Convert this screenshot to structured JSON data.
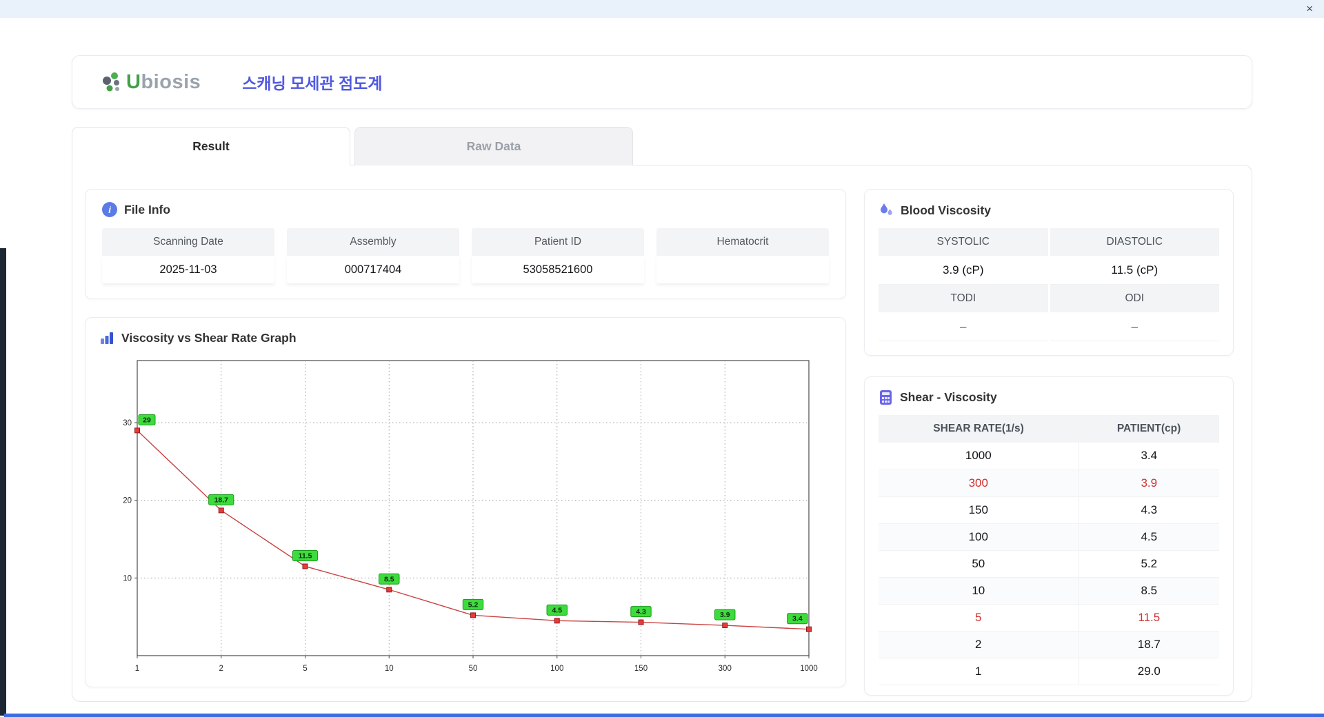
{
  "window": {
    "close_label": "×"
  },
  "header": {
    "brand_u": "U",
    "brand_rest": "biosis",
    "title_korean": "스캐닝 모세관 점도계"
  },
  "tabs": [
    {
      "label": "Result",
      "active": true
    },
    {
      "label": "Raw Data",
      "active": false
    }
  ],
  "icons": {
    "info_glyph": "i"
  },
  "file_info": {
    "title": "File Info",
    "fields": [
      {
        "label": "Scanning Date",
        "value": "2025-11-03"
      },
      {
        "label": "Assembly",
        "value": "000717404"
      },
      {
        "label": "Patient ID",
        "value": "53058521600"
      },
      {
        "label": "Hematocrit",
        "value": ""
      }
    ]
  },
  "blood_viscosity": {
    "title": "Blood Viscosity",
    "cells": [
      {
        "label": "SYSTOLIC",
        "value": "3.9 (cP)"
      },
      {
        "label": "DIASTOLIC",
        "value": "11.5 (cP)"
      },
      {
        "label": "TODI",
        "value": "–"
      },
      {
        "label": "ODI",
        "value": "–"
      }
    ]
  },
  "shear_table": {
    "title": "Shear - Viscosity",
    "columns": [
      "SHEAR RATE(1/s)",
      "PATIENT(cp)"
    ],
    "rows": [
      {
        "shear": "1000",
        "patient": "3.4",
        "highlight": false
      },
      {
        "shear": "300",
        "patient": "3.9",
        "highlight": true
      },
      {
        "shear": "150",
        "patient": "4.3",
        "highlight": false
      },
      {
        "shear": "100",
        "patient": "4.5",
        "highlight": false
      },
      {
        "shear": "50",
        "patient": "5.2",
        "highlight": false
      },
      {
        "shear": "10",
        "patient": "8.5",
        "highlight": false
      },
      {
        "shear": "5",
        "patient": "11.5",
        "highlight": true
      },
      {
        "shear": "2",
        "patient": "18.7",
        "highlight": false
      },
      {
        "shear": "1",
        "patient": "29.0",
        "highlight": false
      }
    ]
  },
  "chart_data": {
    "type": "line",
    "title": "Viscosity vs Shear Rate Graph",
    "categories": [
      "1",
      "2",
      "5",
      "10",
      "50",
      "100",
      "150",
      "300",
      "1000"
    ],
    "values": [
      29,
      18.7,
      11.5,
      8.5,
      5.2,
      4.5,
      4.3,
      3.9,
      3.4
    ],
    "point_labels": [
      "29",
      "18.7",
      "11.5",
      "8.5",
      "5.2",
      "4.5",
      "4.3",
      "3.9",
      "3.4"
    ],
    "xlabel": "",
    "ylabel": "",
    "y_ticks": [
      10,
      20,
      30
    ],
    "ylim": [
      0,
      38
    ],
    "x_scale": "categorical-log-ticks",
    "grid": "dotted",
    "legend": "none",
    "line_color": "#c94343",
    "marker_color": "#e63b3b",
    "marker_stroke": "#8f1d1d",
    "label_bg": "#3ddc3d",
    "label_stroke": "#169a16"
  },
  "colors": {
    "accent_blue": "#5059e0",
    "brand_green": "#43a047",
    "highlight_red": "#d32f2f",
    "header_grey": "#f3f4f6"
  }
}
